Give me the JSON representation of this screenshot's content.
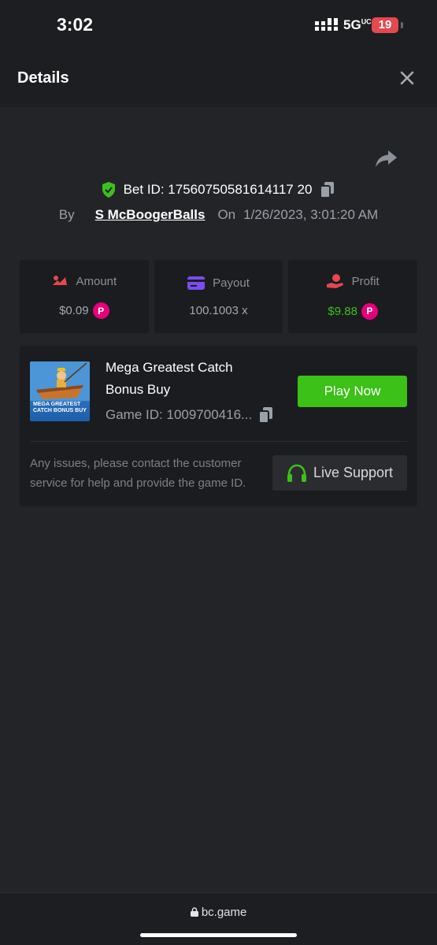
{
  "status": {
    "time": "3:02",
    "network": "5G",
    "network_sup": "UC",
    "battery": "19"
  },
  "header": {
    "title": "Details"
  },
  "bet": {
    "label": "Bet ID:",
    "id": "17560750581614117 20",
    "by_label": "By",
    "username": "S McBoogerBalls",
    "on_label": "On",
    "datetime": "1/26/2023, 3:01:20 AM"
  },
  "stats": {
    "amount_label": "Amount",
    "amount_value": "$0.09",
    "payout_label": "Payout",
    "payout_value": "100.1003 x",
    "profit_label": "Profit",
    "profit_value": "$9.88"
  },
  "game": {
    "name": "Mega Greatest Catch Bonus Buy",
    "thumb_text": "MEGA GREATEST CATCH BONUS BUY",
    "id_label": "Game ID:",
    "id_value": "1009700416...",
    "play_label": "Play Now",
    "help_text": "Any issues, please contact the customer service for help and provide the game ID.",
    "support_label": "Live Support"
  },
  "browser": {
    "url": "bc.game"
  },
  "colors": {
    "accent_green": "#3bc117",
    "coin_pink": "#e6007a",
    "background": "#232428"
  }
}
